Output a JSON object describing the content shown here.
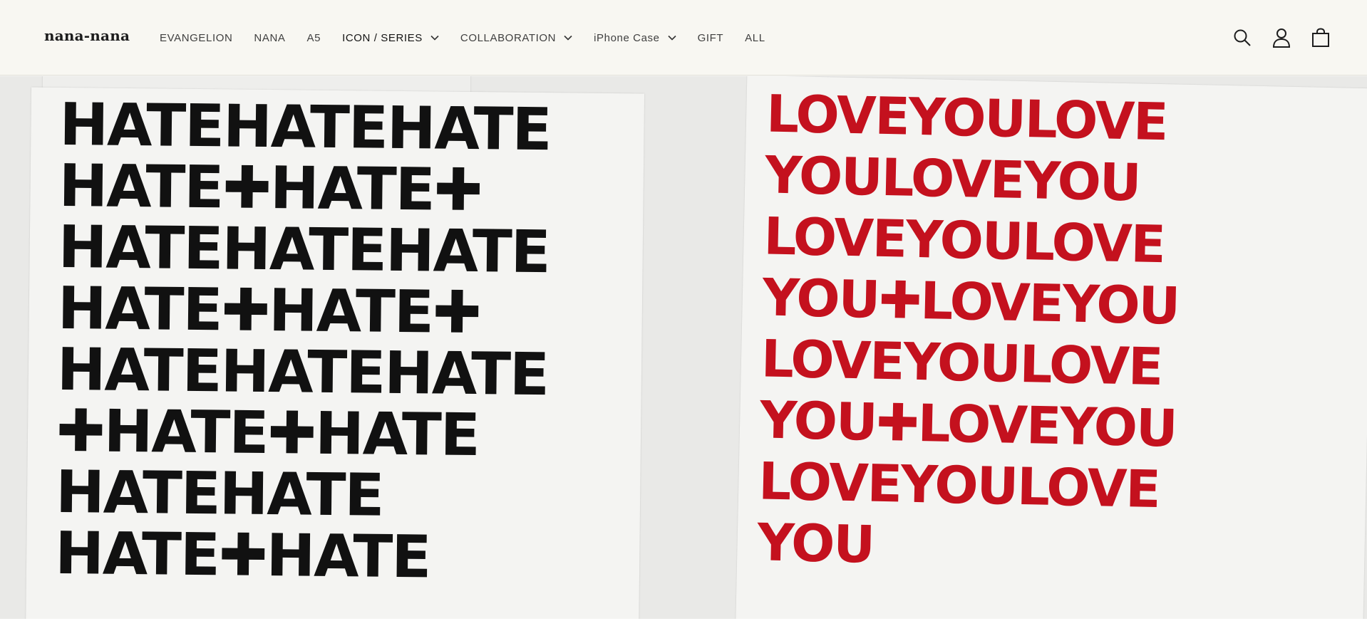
{
  "header": {
    "logo": "nana-nana",
    "nav": [
      {
        "label": "EVANGELION",
        "dropdown": false
      },
      {
        "label": "NANA",
        "dropdown": false
      },
      {
        "label": "A5",
        "dropdown": false
      },
      {
        "label": "ICON / SERIES",
        "dropdown": true,
        "active": true
      },
      {
        "label": "COLLABORATION",
        "dropdown": true
      },
      {
        "label": "iPhone Case",
        "dropdown": true
      },
      {
        "label": "GIFT",
        "dropdown": false
      },
      {
        "label": "ALL",
        "dropdown": false
      }
    ],
    "icons": [
      "search-icon",
      "account-icon",
      "cart-icon"
    ]
  },
  "hero": {
    "left_art_lines": [
      "HATEHATEHATE",
      "HATE✚HATE✚",
      "HATEHATEHATE",
      "HATE✚HATE✚",
      "HATEHATEHATE",
      "✚HATE✚HATE",
      "HATEHATE",
      "HATE✚HATE"
    ],
    "right_art_lines": [
      "LOVEYOULOVE",
      "YOULOVEYOU",
      "LOVEYOULOVE",
      "YOU✚LOVEYOU",
      "LOVEYOULOVE",
      "YOU✚LOVEYOU",
      "LOVEYOULOVE",
      "YOU"
    ],
    "colors": {
      "left_paint": "#111111",
      "right_paint": "#c4111e"
    }
  }
}
